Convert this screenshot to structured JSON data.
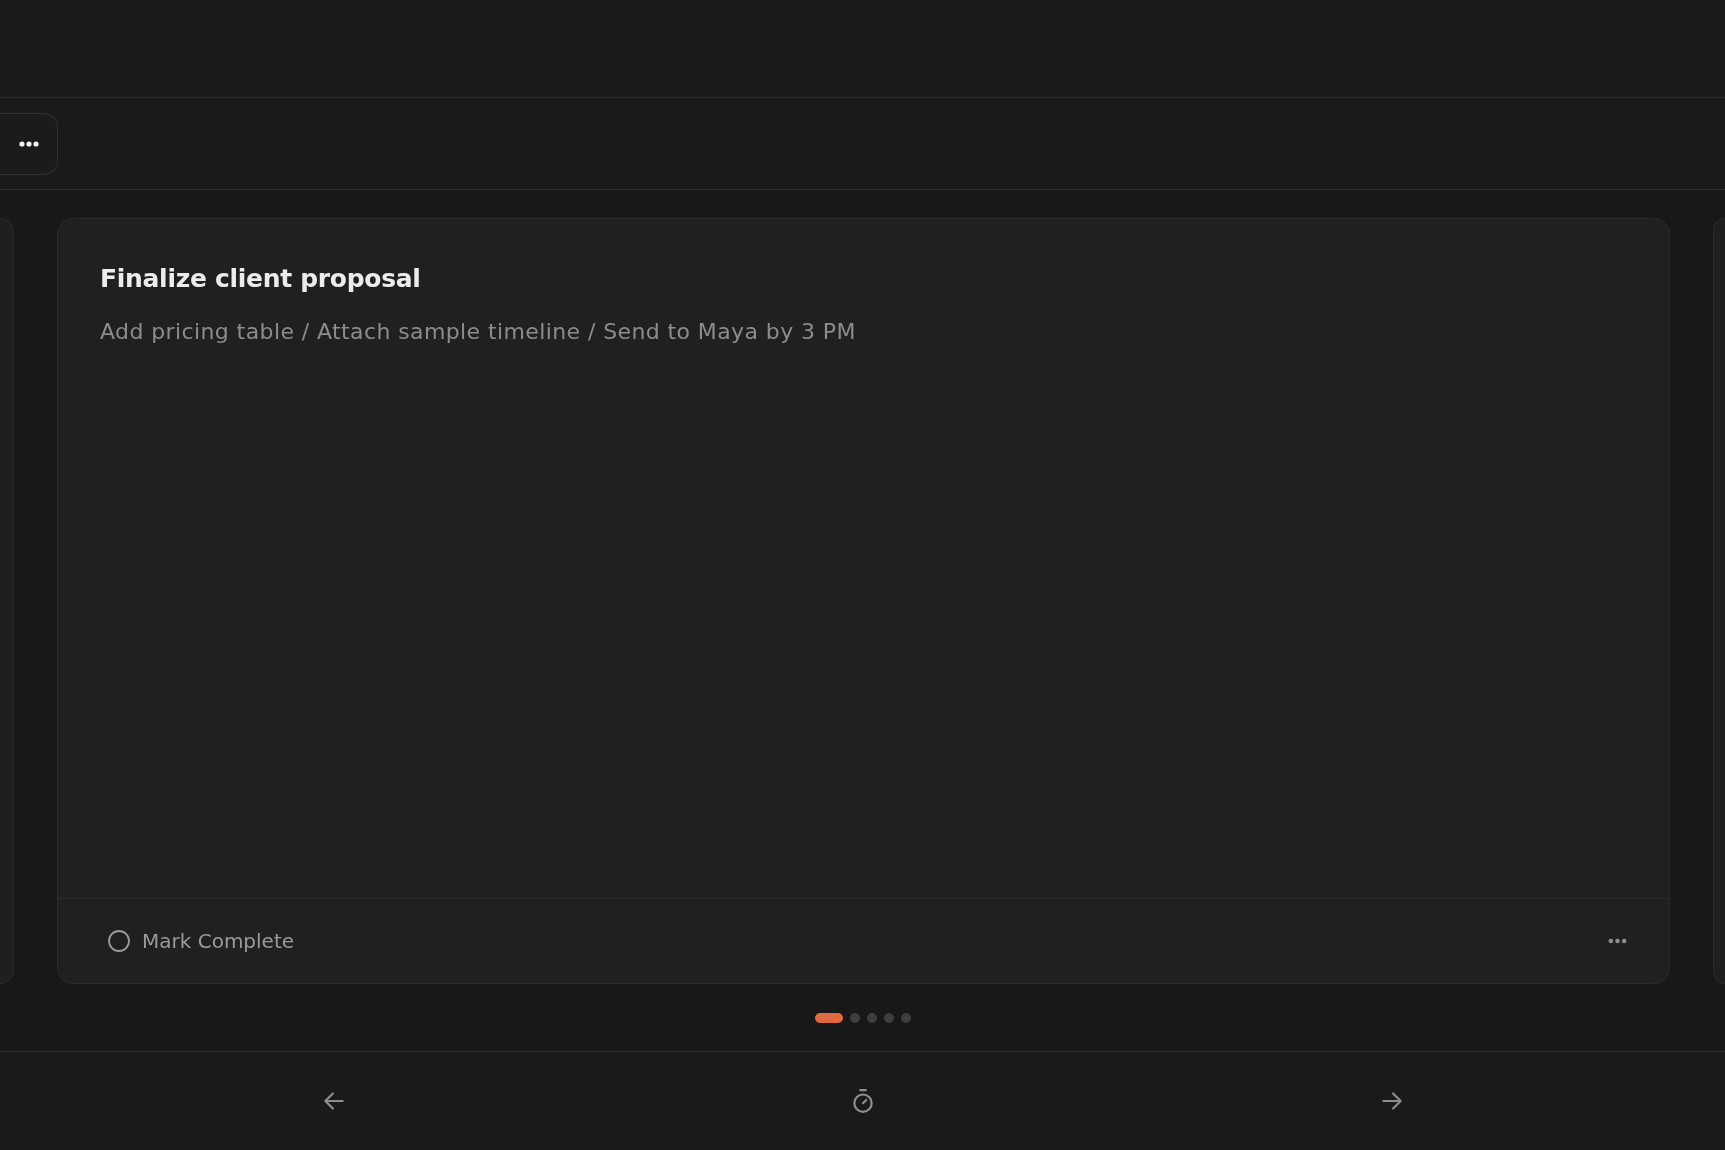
{
  "task_card": {
    "title": "Finalize client proposal",
    "subtitle": "Add pricing table / Attach sample timeline / Send to Maya by 3 PM",
    "complete_label": "Mark Complete",
    "completed": false
  },
  "pagination": [
    {
      "selected": true
    },
    {
      "selected": false
    },
    {
      "selected": false
    },
    {
      "selected": false
    },
    {
      "selected": false
    }
  ]
}
